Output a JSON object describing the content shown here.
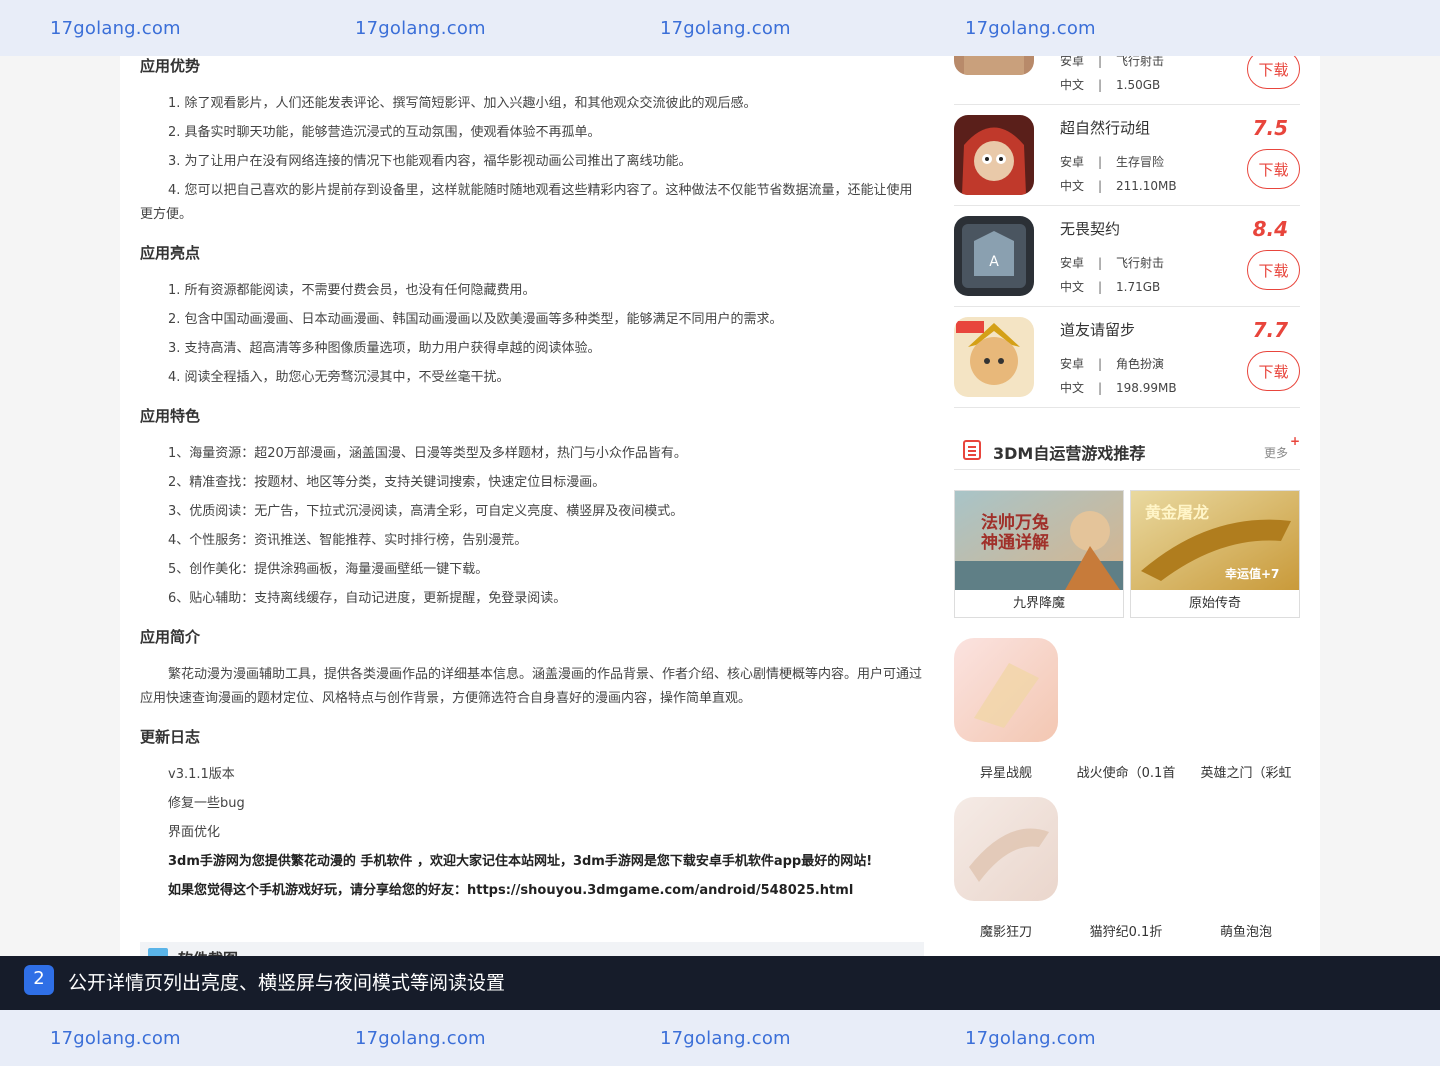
{
  "watermark": {
    "text": "17golang.com"
  },
  "article": {
    "sections": [
      {
        "title": "应用优势",
        "paragraphs": [
          "1. 除了观看影片，人们还能发表评论、撰写简短影评、加入兴趣小组，和其他观众交流彼此的观后感。",
          "2. 具备实时聊天功能，能够营造沉浸式的互动氛围，使观看体验不再孤单。",
          "3. 为了让用户在没有网络连接的情况下也能观看内容，福华影视动画公司推出了离线功能。",
          "4. 您可以把自己喜欢的影片提前存到设备里，这样就能随时随地观看这些精彩内容了。这种做法不仅能节省数据流量，还能让使用更方便。"
        ]
      },
      {
        "title": "应用亮点",
        "paragraphs": [
          "1. 所有资源都能阅读，不需要付费会员，也没有任何隐藏费用。",
          "2. 包含中国动画漫画、日本动画漫画、韩国动画漫画以及欧美漫画等多种类型，能够满足不同用户的需求。",
          "3. 支持高清、超高清等多种图像质量选项，助力用户获得卓越的阅读体验。",
          "4. 阅读全程插入，助您心无旁骛沉浸其中，不受丝毫干扰。"
        ]
      },
      {
        "title": "应用特色",
        "paragraphs": [
          "1、海量资源：超20万部漫画，涵盖国漫、日漫等类型及多样题材，热门与小众作品皆有。",
          "2、精准查找：按题材、地区等分类，支持关键词搜索，快速定位目标漫画。",
          "3、优质阅读：无广告，下拉式沉浸阅读，高清全彩，可自定义亮度、横竖屏及夜间模式。",
          "4、个性服务：资讯推送、智能推荐、实时排行榜，告别漫荒。",
          "5、创作美化：提供涂鸦画板，海量漫画壁纸一键下载。",
          "6、贴心辅助：支持离线缓存，自动记进度，更新提醒，免登录阅读。"
        ]
      },
      {
        "title": "应用简介",
        "paragraphs": [
          "繁花动漫为漫画辅助工具，提供各类漫画作品的详细基本信息。涵盖漫画的作品背景、作者介绍、核心剧情梗概等内容。用户可通过应用快速查询漫画的题材定位、风格特点与创作背景，方便筛选符合自身喜好的漫画内容，操作简单直观。"
        ]
      },
      {
        "title": "更新日志",
        "paragraphs": [
          "v3.1.1版本",
          "修复一些bug",
          "界面优化"
        ],
        "bold_lines": [
          "3dm手游网为您提供繁花动漫的 手机软件 ，欢迎大家记住本站网址，3dm手游网是您下载安卓手机软件app最好的网站!",
          "如果您觉得这个手机游戏好玩，请分享给您的好友：https://shouyou.3dmgame.com/android/548025.html"
        ]
      }
    ],
    "screenshots_title": "软件截图"
  },
  "sidebar": {
    "download_label": "下载",
    "games": [
      {
        "name": "",
        "score": "",
        "platform": "安卓",
        "category": "飞行射击",
        "lang": "中文",
        "size": "1.50GB"
      },
      {
        "name": "超自然行动组",
        "score": "7.5",
        "platform": "安卓",
        "category": "生存冒险",
        "lang": "中文",
        "size": "211.10MB"
      },
      {
        "name": "无畏契约",
        "score": "8.4",
        "platform": "安卓",
        "category": "飞行射击",
        "lang": "中文",
        "size": "1.71GB"
      },
      {
        "name": "道友请留步",
        "score": "7.7",
        "platform": "安卓",
        "category": "角色扮演",
        "lang": "中文",
        "size": "198.99MB"
      }
    ],
    "recommend": {
      "title": "3DM自运营游戏推荐",
      "more": "更多",
      "plus": "+",
      "banners": [
        {
          "name": "九界降魔",
          "overlay": "法帅万兔 神通详解"
        },
        {
          "name": "原始传奇",
          "overlay": "黄金屠龙",
          "overlay2": "幸运值+7"
        }
      ],
      "tiles": [
        "异星战舰",
        "战火使命（0.1首",
        "英雄之门（彩虹",
        "魔影狂刀",
        "猫狩纪0.1折",
        "萌鱼泡泡"
      ]
    }
  },
  "caption": {
    "number": "2",
    "text": "公开详情页列出亮度、横竖屏与夜间模式等阅读设置"
  }
}
